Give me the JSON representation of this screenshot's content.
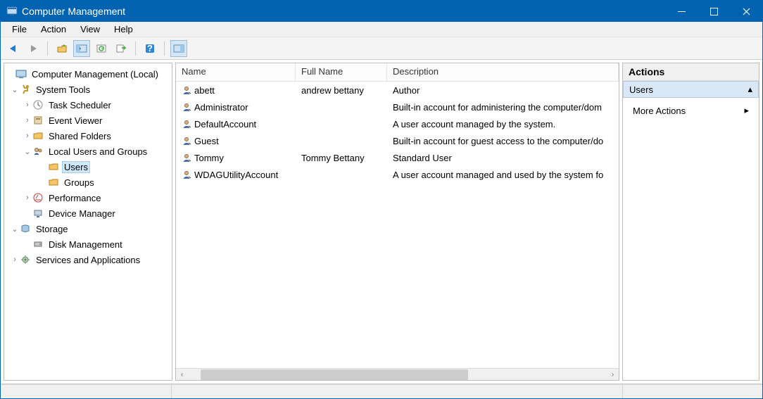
{
  "window": {
    "title": "Computer Management"
  },
  "menu": {
    "file": "File",
    "action": "Action",
    "view": "View",
    "help": "Help"
  },
  "tree": {
    "root": "Computer Management (Local)",
    "system_tools": "System Tools",
    "task_scheduler": "Task Scheduler",
    "event_viewer": "Event Viewer",
    "shared_folders": "Shared Folders",
    "local_users": "Local Users and Groups",
    "users": "Users",
    "groups": "Groups",
    "performance": "Performance",
    "device_manager": "Device Manager",
    "storage": "Storage",
    "disk_management": "Disk Management",
    "services_apps": "Services and Applications"
  },
  "list": {
    "columns": {
      "name": "Name",
      "full_name": "Full Name",
      "description": "Description"
    },
    "rows": [
      {
        "name": "abett",
        "full_name": "andrew bettany",
        "description": "Author"
      },
      {
        "name": "Administrator",
        "full_name": "",
        "description": "Built-in account for administering the computer/dom"
      },
      {
        "name": "DefaultAccount",
        "full_name": "",
        "description": "A user account managed by the system."
      },
      {
        "name": "Guest",
        "full_name": "",
        "description": "Built-in account for guest access to the computer/do"
      },
      {
        "name": "Tommy",
        "full_name": "Tommy Bettany",
        "description": "Standard User"
      },
      {
        "name": "WDAGUtilityAccount",
        "full_name": "",
        "description": "A user account managed and used by the system fo"
      }
    ]
  },
  "actions": {
    "title": "Actions",
    "context": "Users",
    "more": "More Actions"
  }
}
